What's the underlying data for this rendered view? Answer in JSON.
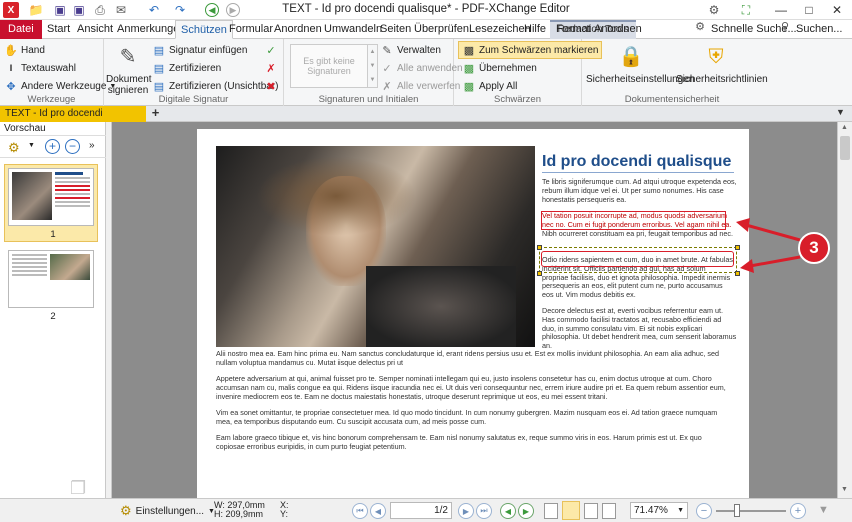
{
  "window": {
    "title": "TEXT - Id pro docendi qualisque* - PDF-XChange Editor",
    "context_tab_group": "Redaction Tools"
  },
  "ribbon_tabs": [
    "Datei",
    "Start",
    "Ansicht",
    "Anmerkungen",
    "Schützen",
    "Formular",
    "Anordnen",
    "Umwandeln",
    "Seiten",
    "Überprüfen",
    "Lesezeichen",
    "Hilfe",
    "Format",
    "Anordnen"
  ],
  "active_tab": "Schützen",
  "tab_right": {
    "quick_search": "Schnelle Suche...",
    "search": "Suchen..."
  },
  "ribbon": {
    "tools": {
      "hand": "Hand",
      "text_select": "Textauswahl",
      "other_tools": "Andere Werkzeuge",
      "label": "Werkzeuge"
    },
    "signature": {
      "sign_document": "Dokument signieren",
      "insert_signature": "Signatur einfügen",
      "certify": "Zertifizieren",
      "certify_invisible": "Zertifizieren (Unsichtbar)",
      "label": "Digitale Signatur"
    },
    "sig_initials": {
      "placeholder": "Es gibt keine Signaturen",
      "manage": "Verwalten",
      "apply_all": "Alle anwenden",
      "discard_all": "Alle verwerfen",
      "label": "Signaturen und Initialen"
    },
    "redaction": {
      "mark_for_redaction": "Zum Schwärzen markieren",
      "apply_redaction": "Übernehmen",
      "apply_all": "Apply All",
      "label": "Schwärzen"
    },
    "security": {
      "security_settings": "Sicherheitseinstellungen",
      "security_policies": "Sicherheitsrichtlinien",
      "label": "Dokumentensicherheit"
    }
  },
  "doc_tab": {
    "label": "TEXT - Id pro docendi qualisque *"
  },
  "left_panel": {
    "title": "Vorschau",
    "pages": [
      "1",
      "2"
    ]
  },
  "page": {
    "heading": "Id pro docendi qualisque",
    "para1": "Te libris signiferumque cum. Ad atqui utroque expetenda eos, rebum illum idque vel ei. Ut per sumo nonumes. His case honestatis persequeris ea.",
    "marked1": "Vel tation posuit incorrupte ad, modus quodsi adversarium nec no. Cum ei fugit ponderum erroribus. Vel agam nihil ea.",
    "para2_rest": "Nibh ocurreret constituam ea pri, feugait temporibus ad nec.",
    "marked2": "Odio ridens sapientem et cum, duo in amet brute. At fabulas inciderint sit. Officiis partiendo ad qui, has ad solum propriae facilisis, duo et ignota philosophia. Impedit inermis persequeris an eos, elit putent cum ne, purto accusamus eos ut. Vim modus debitis ex.",
    "para4": "Decore delectus est at, everti vocibus referrentur eam ut. Has commodo facilisi tractatos at, recusabo efficiendi ad duo, in summo consulatu vim. Ei sit nobis explicari philosophia. Ut debet hendrerit mea, cum senserit laboramus an.",
    "full1": "Alii nostro mea ea. Eam hinc prima eu. Nam sanctus concludaturque id, erant ridens persius usu et. Est ex mollis invidunt philosophia. An eam alia adhuc, sed nullam voluptua mandamus cu. Mutat iisque delectus pri ut",
    "full2": "Appetere adversarium at qui, animal fuisset pro te. Semper nominati intellegam qui eu, justo insolens consetetur has cu, enim doctus utroque at cum. Choro accumsan nam cu, malis congue ea qui. Ridens iisque iracundia nec ei. Ut duis veri consequuntur nec, errem iriure audire pri et. Ea quem rebum assentior eum, invenire mediocrem eos te. Eam ne doctus maiestatis honestatis, utroque deserunt reprimique ut eos, eu mei essent tritani.",
    "full3": "Vim ea sonet omittantur, te propriae consectetuer mea. Id quo modo tincidunt. In cum nonumy gubergren. Mazim nusquam eos ei. Ad tation graece numquam mea, ea temporibus disputando eum. Cu suscipit accusata cum, ad meis posse cum.",
    "full4": "Eam labore graeco tibique et, vis hinc bonorum comprehensam te. Eam nisl nonumy salutatus ex, reque summo viris in eos. Harum primis est ut. Ex quo copiosae erroribus euripidis, in cum purto feugiat petentium.",
    "callout": "3"
  },
  "statusbar": {
    "settings": "Einstellungen...",
    "width": "W: 297,0mm",
    "height": "H: 209,9mm",
    "x": "X:",
    "y": "Y:",
    "page_field": "1/2",
    "zoom": "71.47%"
  },
  "colors": {
    "accent": "#1f5fa8",
    "datei": "#c8102e",
    "doc_tab": "#f2c300",
    "mark_red": "#d81e2a",
    "canvas": "#8c8c8c"
  }
}
